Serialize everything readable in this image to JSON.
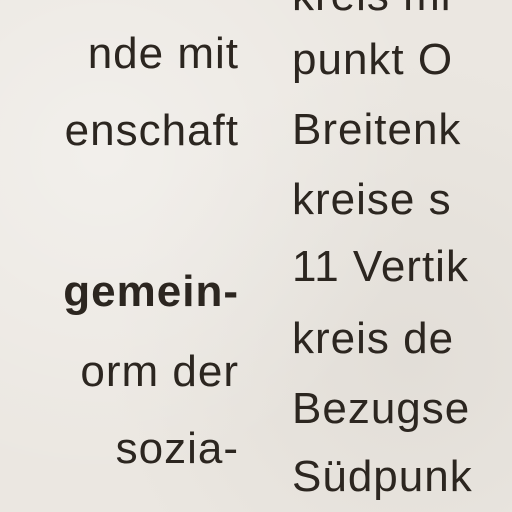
{
  "left_column": {
    "lines": [
      "nde mit",
      "enschaft",
      "gemein-",
      "orm der",
      "sozia-"
    ]
  },
  "right_column": {
    "lines": [
      "kreis mi",
      "punkt O",
      "Breitenk",
      "kreise s",
      "11 Vertik",
      "kreis de",
      "Bezugse",
      "Südpunk"
    ]
  }
}
